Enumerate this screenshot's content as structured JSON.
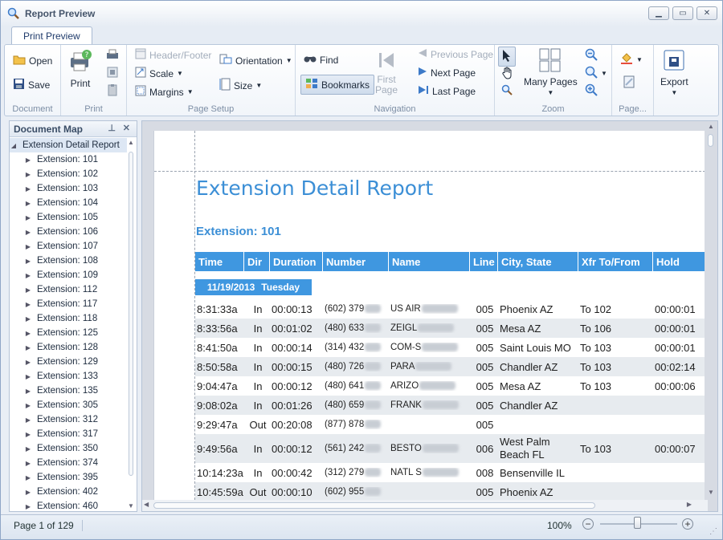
{
  "window": {
    "title": "Report Preview"
  },
  "tabs": [
    {
      "label": "Print Preview"
    }
  ],
  "ribbon": {
    "document": {
      "label": "Document",
      "open": "Open",
      "save": "Save"
    },
    "print": {
      "label": "Print",
      "print": "Print"
    },
    "page_setup": {
      "label": "Page Setup",
      "header_footer": "Header/Footer",
      "scale": "Scale",
      "margins": "Margins",
      "orientation": "Orientation",
      "size": "Size"
    },
    "navigation": {
      "label": "Navigation",
      "find": "Find",
      "bookmarks": "Bookmarks",
      "first_page": "First Page",
      "previous_page": "Previous Page",
      "next_page": "Next Page",
      "last_page": "Last Page"
    },
    "zoom": {
      "label": "Zoom",
      "many_pages": "Many Pages"
    },
    "page": {
      "label": "Page..."
    },
    "export": {
      "label": "Export"
    }
  },
  "document_map": {
    "title": "Document Map",
    "root": "Extension Detail Report",
    "items": [
      "Extension: 101",
      "Extension: 102",
      "Extension: 103",
      "Extension: 104",
      "Extension: 105",
      "Extension: 106",
      "Extension: 107",
      "Extension: 108",
      "Extension: 109",
      "Extension: 112",
      "Extension: 117",
      "Extension: 118",
      "Extension: 125",
      "Extension: 128",
      "Extension: 129",
      "Extension: 133",
      "Extension: 135",
      "Extension: 305",
      "Extension: 312",
      "Extension: 317",
      "Extension: 350",
      "Extension: 374",
      "Extension: 395",
      "Extension: 402",
      "Extension: 460"
    ]
  },
  "report": {
    "title": "Extension Detail Report",
    "extension_heading": "Extension: 101",
    "columns": [
      "Time",
      "Dir",
      "Duration",
      "Number",
      "Name",
      "Line",
      "City, State",
      "Xfr To/From",
      "Hold"
    ],
    "date_band": {
      "date": "11/19/2013",
      "day": "Tuesday"
    },
    "rows": [
      {
        "time": "8:31:33a",
        "dir": "In",
        "duration": "00:00:13",
        "number": "(602) 379",
        "name": "US AIR",
        "line": "005",
        "city": "Phoenix AZ",
        "xfr": "To 102",
        "hold": "00:00:01"
      },
      {
        "time": "8:33:56a",
        "dir": "In",
        "duration": "00:01:02",
        "number": "(480) 633",
        "name": "ZEIGL",
        "line": "005",
        "city": "Mesa AZ",
        "xfr": "To 106",
        "hold": "00:00:01"
      },
      {
        "time": "8:41:50a",
        "dir": "In",
        "duration": "00:00:14",
        "number": "(314) 432",
        "name": "COM-S",
        "line": "005",
        "city": "Saint Louis MO",
        "xfr": "To 103",
        "hold": "00:00:01"
      },
      {
        "time": "8:50:58a",
        "dir": "In",
        "duration": "00:00:15",
        "number": "(480) 726",
        "name": "PARA",
        "line": "005",
        "city": "Chandler AZ",
        "xfr": "To 103",
        "hold": "00:02:14"
      },
      {
        "time": "9:04:47a",
        "dir": "In",
        "duration": "00:00:12",
        "number": "(480) 641",
        "name": "ARIZO",
        "line": "005",
        "city": "Mesa AZ",
        "xfr": "To 103",
        "hold": "00:00:06"
      },
      {
        "time": "9:08:02a",
        "dir": "In",
        "duration": "00:01:26",
        "number": "(480) 659",
        "name": "FRANK",
        "line": "005",
        "city": "Chandler AZ",
        "xfr": "",
        "hold": ""
      },
      {
        "time": "9:29:47a",
        "dir": "Out",
        "duration": "00:20:08",
        "number": "(877) 878",
        "name": "",
        "line": "005",
        "city": "",
        "xfr": "",
        "hold": ""
      },
      {
        "time": "9:49:56a",
        "dir": "In",
        "duration": "00:00:12",
        "number": "(561) 242",
        "name": "BESTO",
        "line": "006",
        "city": "West Palm Beach FL",
        "xfr": "To 103",
        "hold": "00:00:07"
      },
      {
        "time": "10:14:23a",
        "dir": "In",
        "duration": "00:00:42",
        "number": "(312) 279",
        "name": "NATL S",
        "line": "008",
        "city": "Bensenville IL",
        "xfr": "",
        "hold": ""
      },
      {
        "time": "10:45:59a",
        "dir": "Out",
        "duration": "00:00:10",
        "number": "(602) 955",
        "name": "",
        "line": "005",
        "city": "Phoenix AZ",
        "xfr": "",
        "hold": ""
      }
    ]
  },
  "status": {
    "page_info": "Page 1 of 129",
    "zoom_level": "100%"
  },
  "colors": {
    "accent": "#3f97e0",
    "title_blue": "#3c8fd6",
    "row_alt": "#e7ebef"
  }
}
